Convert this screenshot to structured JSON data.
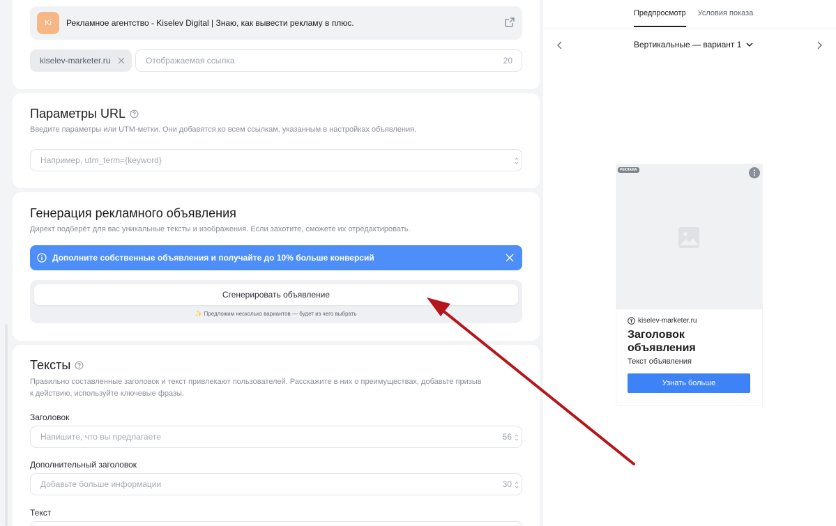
{
  "site": {
    "logo_text": "Ki",
    "title": "Рекламное агентство - Kiselev Digital | Знаю, как вывести рекламу в плюс.",
    "domain": "kiselev-marketer.ru",
    "display_link_placeholder": "Отображаемая ссылка",
    "display_link_counter": "20"
  },
  "url_params": {
    "title": "Параметры URL",
    "description": "Введите параметры или UTM-метки. Они добавятся ко всем ссылкам, указанным в настройках объявления.",
    "placeholder": "Например, utm_term={keyword}"
  },
  "generation": {
    "title": "Генерация рекламного объявления",
    "description": "Директ подберёт для вас уникальные тексты и изображения. Если захотите, сможете их отредактировать.",
    "banner_text": "Дополните собственные объявления и получайте до 10% больше конверсий",
    "generate_button": "Сгенерировать объявление",
    "hint": "✨ Предложим несколько вариантов — будет из чего выбрать"
  },
  "texts": {
    "title": "Тексты",
    "description_line1": "Правильно составленные заголовок и текст привлекают пользователей. Расскажите в них о преимуществах, добавьте призыв",
    "description_line2": "к действию, используйте ключевые фразы.",
    "headline_label": "Заголовок",
    "headline_placeholder": "Напишите, что вы предлагаете",
    "headline_counter": "56",
    "subheadline_label": "Дополнительный заголовок",
    "subheadline_placeholder": "Добавьте больше информации",
    "subheadline_counter": "30",
    "text_label": "Текст"
  },
  "preview": {
    "tabs": [
      "Предпросмотр",
      "Условия показа"
    ],
    "active_tab": 0,
    "variant": "Вертикальные — вариант 1",
    "ad": {
      "badge": "РЕКЛАМА",
      "domain": "kiselev-marketer.ru",
      "headline": "Заголовок объявления",
      "text": "Текст объявления",
      "cta": "Узнать больше"
    }
  },
  "colors": {
    "banner": "#4d8ef8",
    "cta": "#3e82f7",
    "annotation_arrow": "#b5161b"
  }
}
